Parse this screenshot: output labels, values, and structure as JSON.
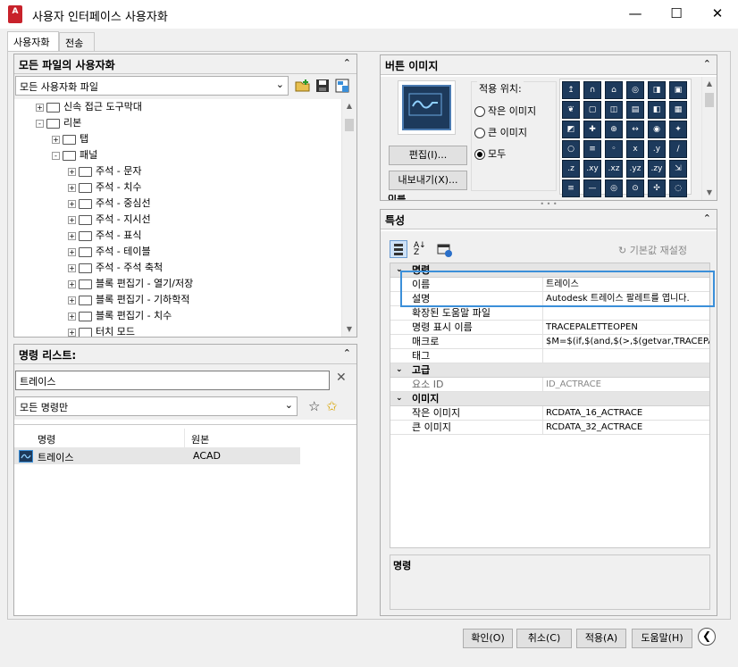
{
  "window": {
    "title": "사용자 인터페이스 사용자화",
    "app_icon_label": "A",
    "minimize": "—",
    "maximize": "☐",
    "close": "✕"
  },
  "tabs": [
    "사용자화",
    "전송"
  ],
  "customizations": {
    "header": "모든 파일의 사용자화",
    "collapse": "⌃",
    "dropdown_value": "모든 사용자화 파일",
    "tree": [
      {
        "label": "신속 접근 도구막대",
        "level": 1,
        "exp": "+"
      },
      {
        "label": "리본",
        "level": 1,
        "exp": "-"
      },
      {
        "label": "탭",
        "level": 2,
        "exp": "+"
      },
      {
        "label": "패널",
        "level": 2,
        "exp": "-"
      },
      {
        "label": "주석 - 문자",
        "level": 3,
        "exp": "+"
      },
      {
        "label": "주석 - 치수",
        "level": 3,
        "exp": "+"
      },
      {
        "label": "주석 - 중심선",
        "level": 3,
        "exp": "+"
      },
      {
        "label": "주석 - 지시선",
        "level": 3,
        "exp": "+"
      },
      {
        "label": "주석 - 표식",
        "level": 3,
        "exp": "+"
      },
      {
        "label": "주석 - 테이블",
        "level": 3,
        "exp": "+"
      },
      {
        "label": "주석 - 주석 축척",
        "level": 3,
        "exp": "+"
      },
      {
        "label": "블록 편집기 - 열기/저장",
        "level": 3,
        "exp": "+"
      },
      {
        "label": "블록 편집기 - 기하학적",
        "level": 3,
        "exp": "+"
      },
      {
        "label": "블록 편집기 - 치수",
        "level": 3,
        "exp": "+"
      },
      {
        "label": "터치 모드",
        "level": 3,
        "exp": "+"
      }
    ]
  },
  "command_list": {
    "header": "명령 리스트:",
    "search_value": "트레이스",
    "clear": "✕",
    "filter_value": "모든 명령만",
    "columns": [
      "명령",
      "원본"
    ],
    "rows": [
      {
        "name": "트레이스",
        "source": "ACAD"
      }
    ]
  },
  "button_image": {
    "header": "버튼 이미지",
    "edit_button": "편집(I)...",
    "export_button": "내보내기(X)...",
    "apply_to_label": "적용 위치:",
    "options": [
      "작은 이미지",
      "큰 이미지",
      "모두"
    ],
    "selected_option": "모두",
    "cut_text": "이름"
  },
  "properties": {
    "header": "특성",
    "reset_label": "기본값 재설정",
    "rows": [
      {
        "type": "cat",
        "name": "명령"
      },
      {
        "type": "prop",
        "name": "이름",
        "value": "트레이스"
      },
      {
        "type": "prop",
        "name": "설명",
        "value": "Autodesk 트레이스 팔레트를 엽니다."
      },
      {
        "type": "prop",
        "name": "확장된 도움말 파일",
        "value": ""
      },
      {
        "type": "prop",
        "name": "명령 표시 이름",
        "value": "TRACEPALETTEOPEN"
      },
      {
        "type": "prop",
        "name": "매크로",
        "value": "$M=$(if,$(and,$(>,$(getvar,TRACEPAL"
      },
      {
        "type": "prop",
        "name": "태그",
        "value": ""
      },
      {
        "type": "cat",
        "name": "고급"
      },
      {
        "type": "prop",
        "name": "요소 ID",
        "value": "ID_ACTRACE",
        "grey": true
      },
      {
        "type": "cat",
        "name": "이미지"
      },
      {
        "type": "prop",
        "name": "작은 이미지",
        "value": "RCDATA_16_ACTRACE"
      },
      {
        "type": "prop",
        "name": "큰 이미지",
        "value": "RCDATA_32_ACTRACE"
      }
    ],
    "description_title": "명령"
  },
  "footer": {
    "ok": "확인(O)",
    "cancel": "취소(C)",
    "apply": "적용(A)",
    "help": "도움말(H)"
  },
  "colors": {
    "highlight_box": "#3b8fd9",
    "icon_bg": "#1d3a5c"
  }
}
